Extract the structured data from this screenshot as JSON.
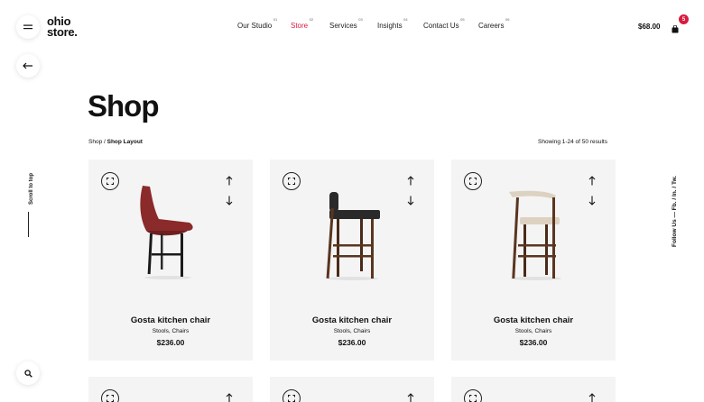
{
  "logo": {
    "line1": "ohio",
    "line2": "store."
  },
  "nav": [
    {
      "label": "Our Studio",
      "num": "01",
      "active": false
    },
    {
      "label": "Store",
      "num": "02",
      "active": true
    },
    {
      "label": "Services",
      "num": "03",
      "active": false
    },
    {
      "label": "Insights",
      "num": "04",
      "active": false
    },
    {
      "label": "Contact Us",
      "num": "05",
      "active": false
    },
    {
      "label": "Careers",
      "num": "06",
      "active": false
    }
  ],
  "cart": {
    "total": "$68.00",
    "count": "5"
  },
  "sidebar": {
    "scroll_label": "Scroll to top"
  },
  "social": {
    "text": "Follow Us — Fb. / In. / Tw."
  },
  "page": {
    "title": "Shop",
    "breadcrumb": {
      "root": "Shop",
      "separator": " / ",
      "current": "Shop Layout"
    },
    "results": "Showing 1-24 of 50 results"
  },
  "products": [
    {
      "name": "Gosta kitchen chair",
      "categories": "Stools, Chairs",
      "price": "$236.00",
      "seat_color": "#8a2a2a",
      "leg_color": "#1a1a1a",
      "style": "shell"
    },
    {
      "name": "Gosta kitchen chair",
      "categories": "Stools, Chairs",
      "price": "$236.00",
      "seat_color": "#2a2a2a",
      "leg_color": "#5a3520",
      "style": "slat"
    },
    {
      "name": "Gosta kitchen chair",
      "categories": "Stools, Chairs",
      "price": "$236.00",
      "seat_color": "#ddd2c2",
      "leg_color": "#5a3520",
      "style": "curve"
    }
  ],
  "colors": {
    "accent": "#d81b3f",
    "card_bg": "#f4f4f4"
  }
}
